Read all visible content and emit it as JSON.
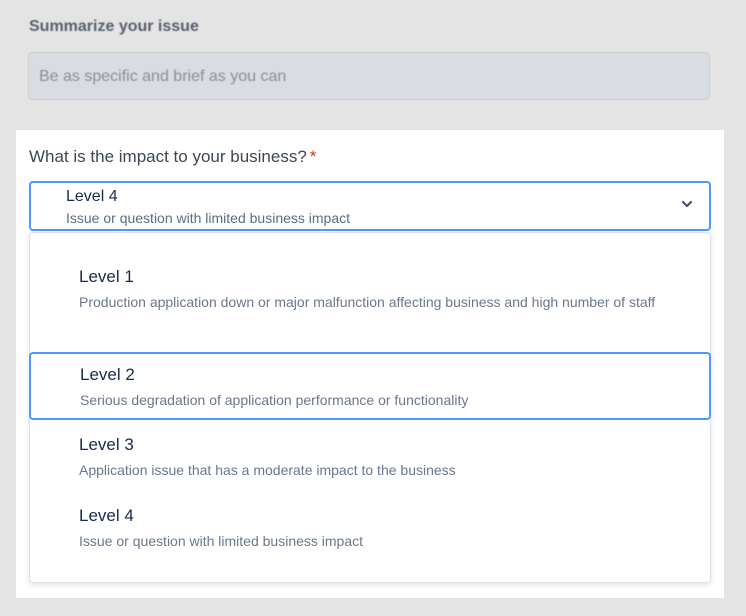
{
  "summary": {
    "label": "Summarize your issue",
    "placeholder": "Be as specific and brief as you can"
  },
  "impact": {
    "label": "What is the impact to your business?",
    "required_mark": "*",
    "selected": {
      "title": "Level 4",
      "description": "Issue or question with limited business impact"
    },
    "options": [
      {
        "title": "Level 1",
        "description": "Production application down or major malfunction affecting business and high number of staff"
      },
      {
        "title": "Level 2",
        "description": "Serious degradation of application performance or functionality"
      },
      {
        "title": "Level 3",
        "description": "Application issue that has a moderate impact to the business"
      },
      {
        "title": "Level 4",
        "description": "Issue or question with limited business impact"
      }
    ],
    "highlighted_option": "Level 2"
  },
  "icons": {
    "select_toggle": "chevron-down-icon"
  },
  "colors": {
    "focus_border": "#4c9aff",
    "required": "#de350b",
    "text_primary": "#172b4d",
    "text_secondary": "#6b778c"
  }
}
